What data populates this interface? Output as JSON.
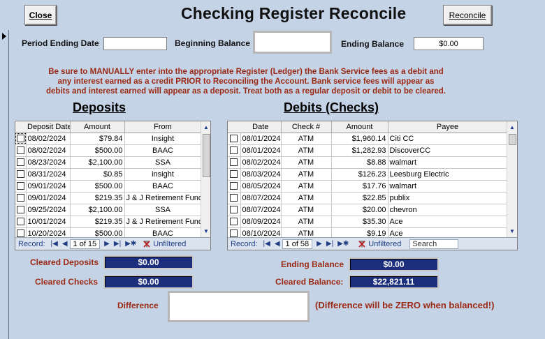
{
  "header": {
    "close_label": "Close",
    "title": "Checking Register Reconcile",
    "reconcile_label": "Reconcile"
  },
  "period": {
    "ending_date_label": "Period Ending Date",
    "ending_date_value": "",
    "beginning_balance_label": "Beginning Balance",
    "beginning_balance_value": "",
    "ending_balance_label": "Ending Balance",
    "ending_balance_value": "$0.00"
  },
  "notice": {
    "line1": "Be sure to MANUALLY enter into the appropriate Register (Ledger) the Bank Service fees as a debit and",
    "line2": "any interest earned as a credit PRIOR to Reconciling the Account.  Bank service fees will appear as",
    "line3": "debits and interest earned will appear as a deposit.  Treat both as a regular deposit or debit to be cleared."
  },
  "deposits": {
    "title": "Deposits",
    "columns": [
      "Deposit Date",
      "Amount",
      "From"
    ],
    "rows": [
      {
        "date": "08/02/2024",
        "amount": "$79.84",
        "from": "Insight"
      },
      {
        "date": "08/02/2024",
        "amount": "$500.00",
        "from": "BAAC"
      },
      {
        "date": "08/23/2024",
        "amount": "$2,100.00",
        "from": "SSA"
      },
      {
        "date": "08/31/2024",
        "amount": "$0.85",
        "from": "insight"
      },
      {
        "date": "09/01/2024",
        "amount": "$500.00",
        "from": "BAAC"
      },
      {
        "date": "09/01/2024",
        "amount": "$219.35",
        "from": "J & J Retirement Fund"
      },
      {
        "date": "09/25/2024",
        "amount": "$2,100.00",
        "from": "SSA"
      },
      {
        "date": "10/01/2024",
        "amount": "$219.35",
        "from": "J & J Retirement Fund"
      },
      {
        "date": "10/20/2024",
        "amount": "$500.00",
        "from": "BAAC"
      }
    ],
    "nav": {
      "record_label": "Record:",
      "position": "1 of 15",
      "filter_label": "Unfiltered"
    }
  },
  "debits": {
    "title": "Debits (Checks)",
    "columns": [
      "Date",
      "Check #",
      "Amount",
      "Payee"
    ],
    "rows": [
      {
        "date": "08/01/2024",
        "check": "ATM",
        "amount": "$1,960.14",
        "payee": "Citi CC"
      },
      {
        "date": "08/01/2024",
        "check": "ATM",
        "amount": "$1,282.93",
        "payee": "DiscoverCC"
      },
      {
        "date": "08/02/2024",
        "check": "ATM",
        "amount": "$8.88",
        "payee": "walmart"
      },
      {
        "date": "08/03/2024",
        "check": "ATM",
        "amount": "$126.23",
        "payee": "Leesburg Electric"
      },
      {
        "date": "08/05/2024",
        "check": "ATM",
        "amount": "$17.76",
        "payee": "walmart"
      },
      {
        "date": "08/07/2024",
        "check": "ATM",
        "amount": "$22.85",
        "payee": "publix"
      },
      {
        "date": "08/07/2024",
        "check": "ATM",
        "amount": "$20.00",
        "payee": "chevron"
      },
      {
        "date": "08/09/2024",
        "check": "ATM",
        "amount": "$35.30",
        "payee": "Ace"
      },
      {
        "date": "08/10/2024",
        "check": "ATM",
        "amount": "$9.19",
        "payee": "Ace"
      }
    ],
    "nav": {
      "record_label": "Record:",
      "position": "1 of 58",
      "filter_label": "Unfiltered",
      "search_placeholder": "Search"
    }
  },
  "summary": {
    "cleared_deposits_label": "Cleared Deposits",
    "cleared_deposits_value": "$0.00",
    "cleared_checks_label": "Cleared Checks",
    "cleared_checks_value": "$0.00",
    "ending_balance_label": "Ending Balance",
    "ending_balance_value": "$0.00",
    "cleared_balance_label": "Cleared Balance:",
    "cleared_balance_value": "$22,821.11",
    "difference_label": "Difference",
    "difference_value": "",
    "difference_hint": "(Difference will be ZERO when balanced!)"
  },
  "colors": {
    "background": "#c5d3e6",
    "accent_red": "#9b2a14",
    "navy": "#1c2e7c"
  }
}
